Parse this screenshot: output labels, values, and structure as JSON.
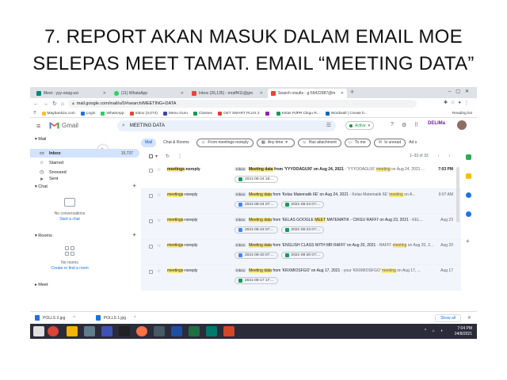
{
  "slide": {
    "title_line1": "7. REPORT AKAN MASUK DALAM EMAIL MOE",
    "title_line2": "SELEPAS MEET TAMAT. EMAIL “MEETING DATA”"
  },
  "browser": {
    "tabs": [
      {
        "label": "Meet - yyy-ooag-uxi",
        "color": "#00897b",
        "active": false
      },
      {
        "label": "(11) WhatsApp",
        "color": "#25d366",
        "active": false
      },
      {
        "label": "Inbox (26,135) - mraff411@gm",
        "color": "#ea4335",
        "active": false
      },
      {
        "label": "Search results - g-59422987@m",
        "color": "#ea4335",
        "active": true
      }
    ],
    "newtab": "+",
    "url": "mail.google.com/mail/u/0/#search/MEETING+DATA",
    "bookmarks": [
      {
        "label": "Maybank2u.com",
        "color": "#fbc02d"
      },
      {
        "label": "Login",
        "color": "#1a73e8"
      },
      {
        "label": "WhatsApp",
        "color": "#25d366"
      },
      {
        "label": "Inbox (3,074)",
        "color": "#ea4335"
      },
      {
        "label": "Menu Guru",
        "color": "#3949ab"
      },
      {
        "label": "Classes",
        "color": "#0f9d58"
      },
      {
        "label": "GET SMART PLUS 3",
        "color": "#e53935"
      },
      {
        "label": "",
        "color": "#8e24aa"
      },
      {
        "label": "Kelas PdPR Cikgu R...",
        "color": "#0f9d58"
      },
      {
        "label": "Wordwall | Create b...",
        "color": "#1565c0"
      }
    ],
    "reading_list": "Reading list"
  },
  "gmail": {
    "logo": "Gmail",
    "search_value": "MEETING DATA",
    "status": "Active",
    "brand": "DELIMa",
    "sidebar": {
      "mail_label": "Mail",
      "items": [
        {
          "label": "Inbox",
          "count": "15,737",
          "icon": "inbox-icon"
        },
        {
          "label": "Starred",
          "count": "",
          "icon": "star-icon"
        },
        {
          "label": "Snoozed",
          "count": "",
          "icon": "clock-icon"
        },
        {
          "label": "Sent",
          "count": "",
          "icon": "send-icon"
        }
      ],
      "chat_label": "Chat",
      "chat_empty": "No conversations",
      "chat_link": "Start a chat",
      "rooms_label": "Rooms",
      "rooms_empty": "No rooms",
      "rooms_link": "Create or find a room",
      "meet_label": "Meet"
    },
    "tabs": [
      {
        "label": "Mail",
        "active": true
      },
      {
        "label": "Chat & Rooms",
        "active": false
      }
    ],
    "filters": [
      {
        "label": "From meetings-noreply",
        "icon": "person-icon"
      },
      {
        "label": "Any time",
        "icon": "calendar-icon"
      },
      {
        "label": "Has attachment",
        "icon": "attachment-icon"
      },
      {
        "label": "To me",
        "icon": "arrow-icon"
      },
      {
        "label": "Is unread",
        "icon": "mail-icon"
      },
      {
        "label": "Ad s",
        "icon": ""
      }
    ],
    "pagination": "1–33 of 33",
    "rows": [
      {
        "sender_hl": "meetings",
        "sender_rest": "-noreply",
        "badge": "Inbox",
        "subj_hl": "Meeting data",
        "subj_rest": " from 'YYYOOAGUXI' on Aug 24, 2021",
        "snip_pre": " - 'YYYOOAGUXI' ",
        "snip_hl": "meeting",
        "snip_post": " on Aug 24, 2021 ...",
        "time": "7:03 PM",
        "unread": true,
        "atts": [
          {
            "label": "2021-08-24 18:...",
            "kind": "green"
          }
        ]
      },
      {
        "sender_hl": "meetings",
        "sender_rest": "-noreply",
        "badge": "Inbox",
        "subj_hl": "Meeting data",
        "subj_rest": " from 'Kelas Matematik 6E' on Aug 24, 2021",
        "snip_pre": " - Kelas Matematik 6E' ",
        "snip_hl": "meeting",
        "snip_post": " on A...",
        "time": "9:07 AM",
        "unread": false,
        "atts": [
          {
            "label": "2021-08-24 07:...",
            "kind": "blue"
          },
          {
            "label": "2021-08-24 07:...",
            "kind": "green"
          }
        ]
      },
      {
        "sender_hl": "meetings",
        "sender_rest": "-noreply",
        "badge": "Inbox",
        "subj_hl": "Meeting data",
        "subj_rest": " from 'KELAS GOOGLE MEET MATEMATIK - CIKGU RAFFI' on Aug 23, 2021",
        "snip_pre": " - KEL...",
        "snip_hl": "",
        "snip_post": "",
        "time": "Aug 23",
        "unread": false,
        "atts": [
          {
            "label": "2021-08-23 07:...",
            "kind": "blue"
          },
          {
            "label": "2021-08-23 07:...",
            "kind": "green"
          }
        ]
      },
      {
        "sender_hl": "meetings",
        "sender_rest": "-noreply",
        "badge": "Inbox",
        "subj_hl": "Meeting data",
        "subj_rest": " from 'ENGLISH CLASS WITH MR RAFFI' on Aug 20, 2021",
        "snip_pre": " - RAFFI' ",
        "snip_hl": "meeting",
        "snip_post": " on Aug 20, 2...",
        "time": "Aug 20",
        "unread": false,
        "atts": [
          {
            "label": "2021-08-20 07:...",
            "kind": "blue"
          },
          {
            "label": "2021-08-20 07:...",
            "kind": "green"
          }
        ]
      },
      {
        "sender_hl": "meetings",
        "sender_rest": "-noreply",
        "badge": "Inbox",
        "subj_hl": "Meeting data",
        "subj_rest": " from 'KRXMIOSFGO' on Aug 17, 2021",
        "snip_pre": " - your 'KRXMIOSFGO' ",
        "snip_hl": "meeting",
        "snip_post": " on Aug 17, ...",
        "time": "Aug 17",
        "unread": false,
        "atts": [
          {
            "label": "2021-08-17 17:...",
            "kind": "green"
          }
        ]
      }
    ]
  },
  "downloads": {
    "items": [
      {
        "label": "POLLS 2.jpg"
      },
      {
        "label": "POLLS 1.jpg"
      }
    ],
    "show_all": "Show all"
  },
  "taskbar": {
    "time": "7:04 PM",
    "date": "24/8/2021",
    "icons": [
      {
        "name": "search-icon",
        "color": "#e0e0e0"
      },
      {
        "name": "chrome-icon",
        "color": "#db4437"
      },
      {
        "name": "file-explorer-icon",
        "color": "#f4b400"
      },
      {
        "name": "app-icon-1",
        "color": "#607d8b"
      },
      {
        "name": "photos-icon",
        "color": "#3f51b5"
      },
      {
        "name": "app-icon-2",
        "color": "#212121"
      },
      {
        "name": "firefox-icon",
        "color": "#ff7043"
      },
      {
        "name": "app-icon-3",
        "color": "#455a64"
      },
      {
        "name": "word-icon",
        "color": "#1e4fa3"
      },
      {
        "name": "excel-icon",
        "color": "#1d6f42"
      },
      {
        "name": "app-icon-4",
        "color": "#00796b"
      },
      {
        "name": "powerpoint-icon",
        "color": "#d24726"
      }
    ]
  }
}
